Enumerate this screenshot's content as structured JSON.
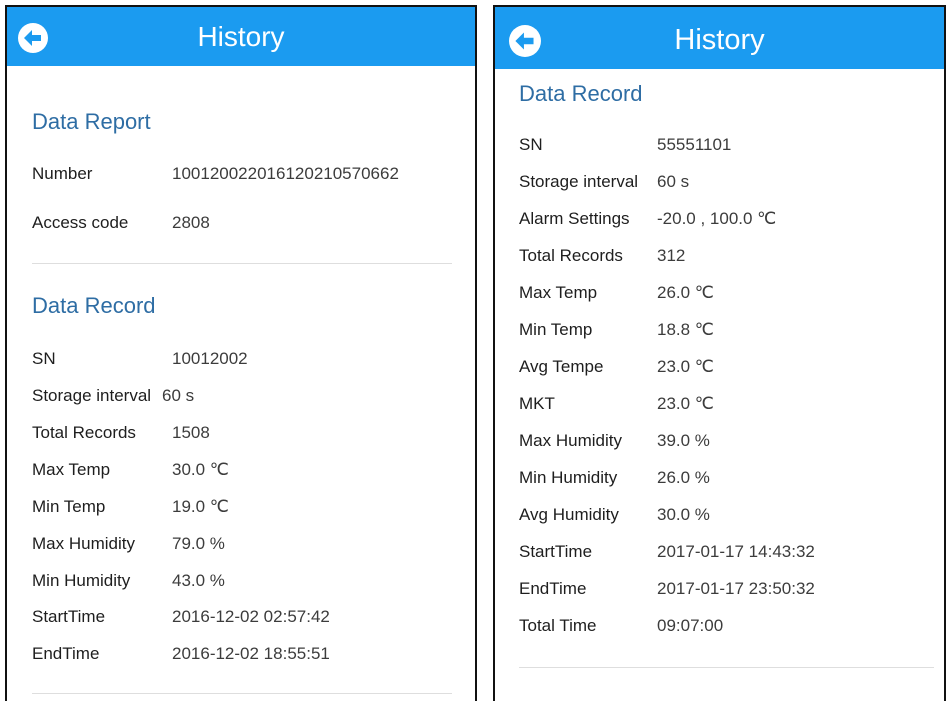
{
  "left_screen": {
    "header": {
      "title": "History"
    },
    "data_report": {
      "title": "Data Report",
      "rows": [
        {
          "label": "Number",
          "value": "10012002201612021057066​2"
        },
        {
          "label": "Access code",
          "value": "2808"
        }
      ]
    },
    "data_record": {
      "title": "Data Record",
      "rows": [
        {
          "label": "SN",
          "value": "10012002"
        },
        {
          "label": "Storage interval",
          "value": "60 s"
        },
        {
          "label": "Total Records",
          "value": "1508"
        },
        {
          "label": "Max Temp",
          "value": "30.0 ℃"
        },
        {
          "label": "Min Temp",
          "value": "19.0 ℃"
        },
        {
          "label": "Max Humidity",
          "value": "79.0 %"
        },
        {
          "label": "Min Humidity",
          "value": "43.0 %"
        },
        {
          "label": "StartTime",
          "value": "2016-12-02 02:57:42"
        },
        {
          "label": "EndTime",
          "value": "2016-12-02 18:55:51"
        }
      ]
    }
  },
  "right_screen": {
    "header": {
      "title": "History"
    },
    "data_record": {
      "title": "Data Record",
      "rows": [
        {
          "label": "SN",
          "value": "55551101"
        },
        {
          "label": "Storage interval",
          "value": "60 s"
        },
        {
          "label": "Alarm Settings",
          "value": "-20.0 , 100.0 ℃"
        },
        {
          "label": "Total Records",
          "value": "312"
        },
        {
          "label": "Max Temp",
          "value": "26.0 ℃"
        },
        {
          "label": "Min Temp",
          "value": "18.8 ℃"
        },
        {
          "label": "Avg Tempe",
          "value": "23.0 ℃"
        },
        {
          "label": "MKT",
          "value": "23.0 ℃"
        },
        {
          "label": "Max Humidity",
          "value": "39.0 %"
        },
        {
          "label": "Min Humidity",
          "value": "26.0 %"
        },
        {
          "label": "Avg Humidity",
          "value": "30.0 %"
        },
        {
          "label": "StartTime",
          "value": "2017-01-17 14:43:32"
        },
        {
          "label": "EndTime",
          "value": "2017-01-17 23:50:32"
        },
        {
          "label": "Total Time",
          "value": "09:07:00"
        }
      ]
    }
  },
  "theme": {
    "accent": "#1b9bf0",
    "section_title_color": "#2e6da4"
  },
  "icons": {
    "back": "arrow-left-circle"
  }
}
